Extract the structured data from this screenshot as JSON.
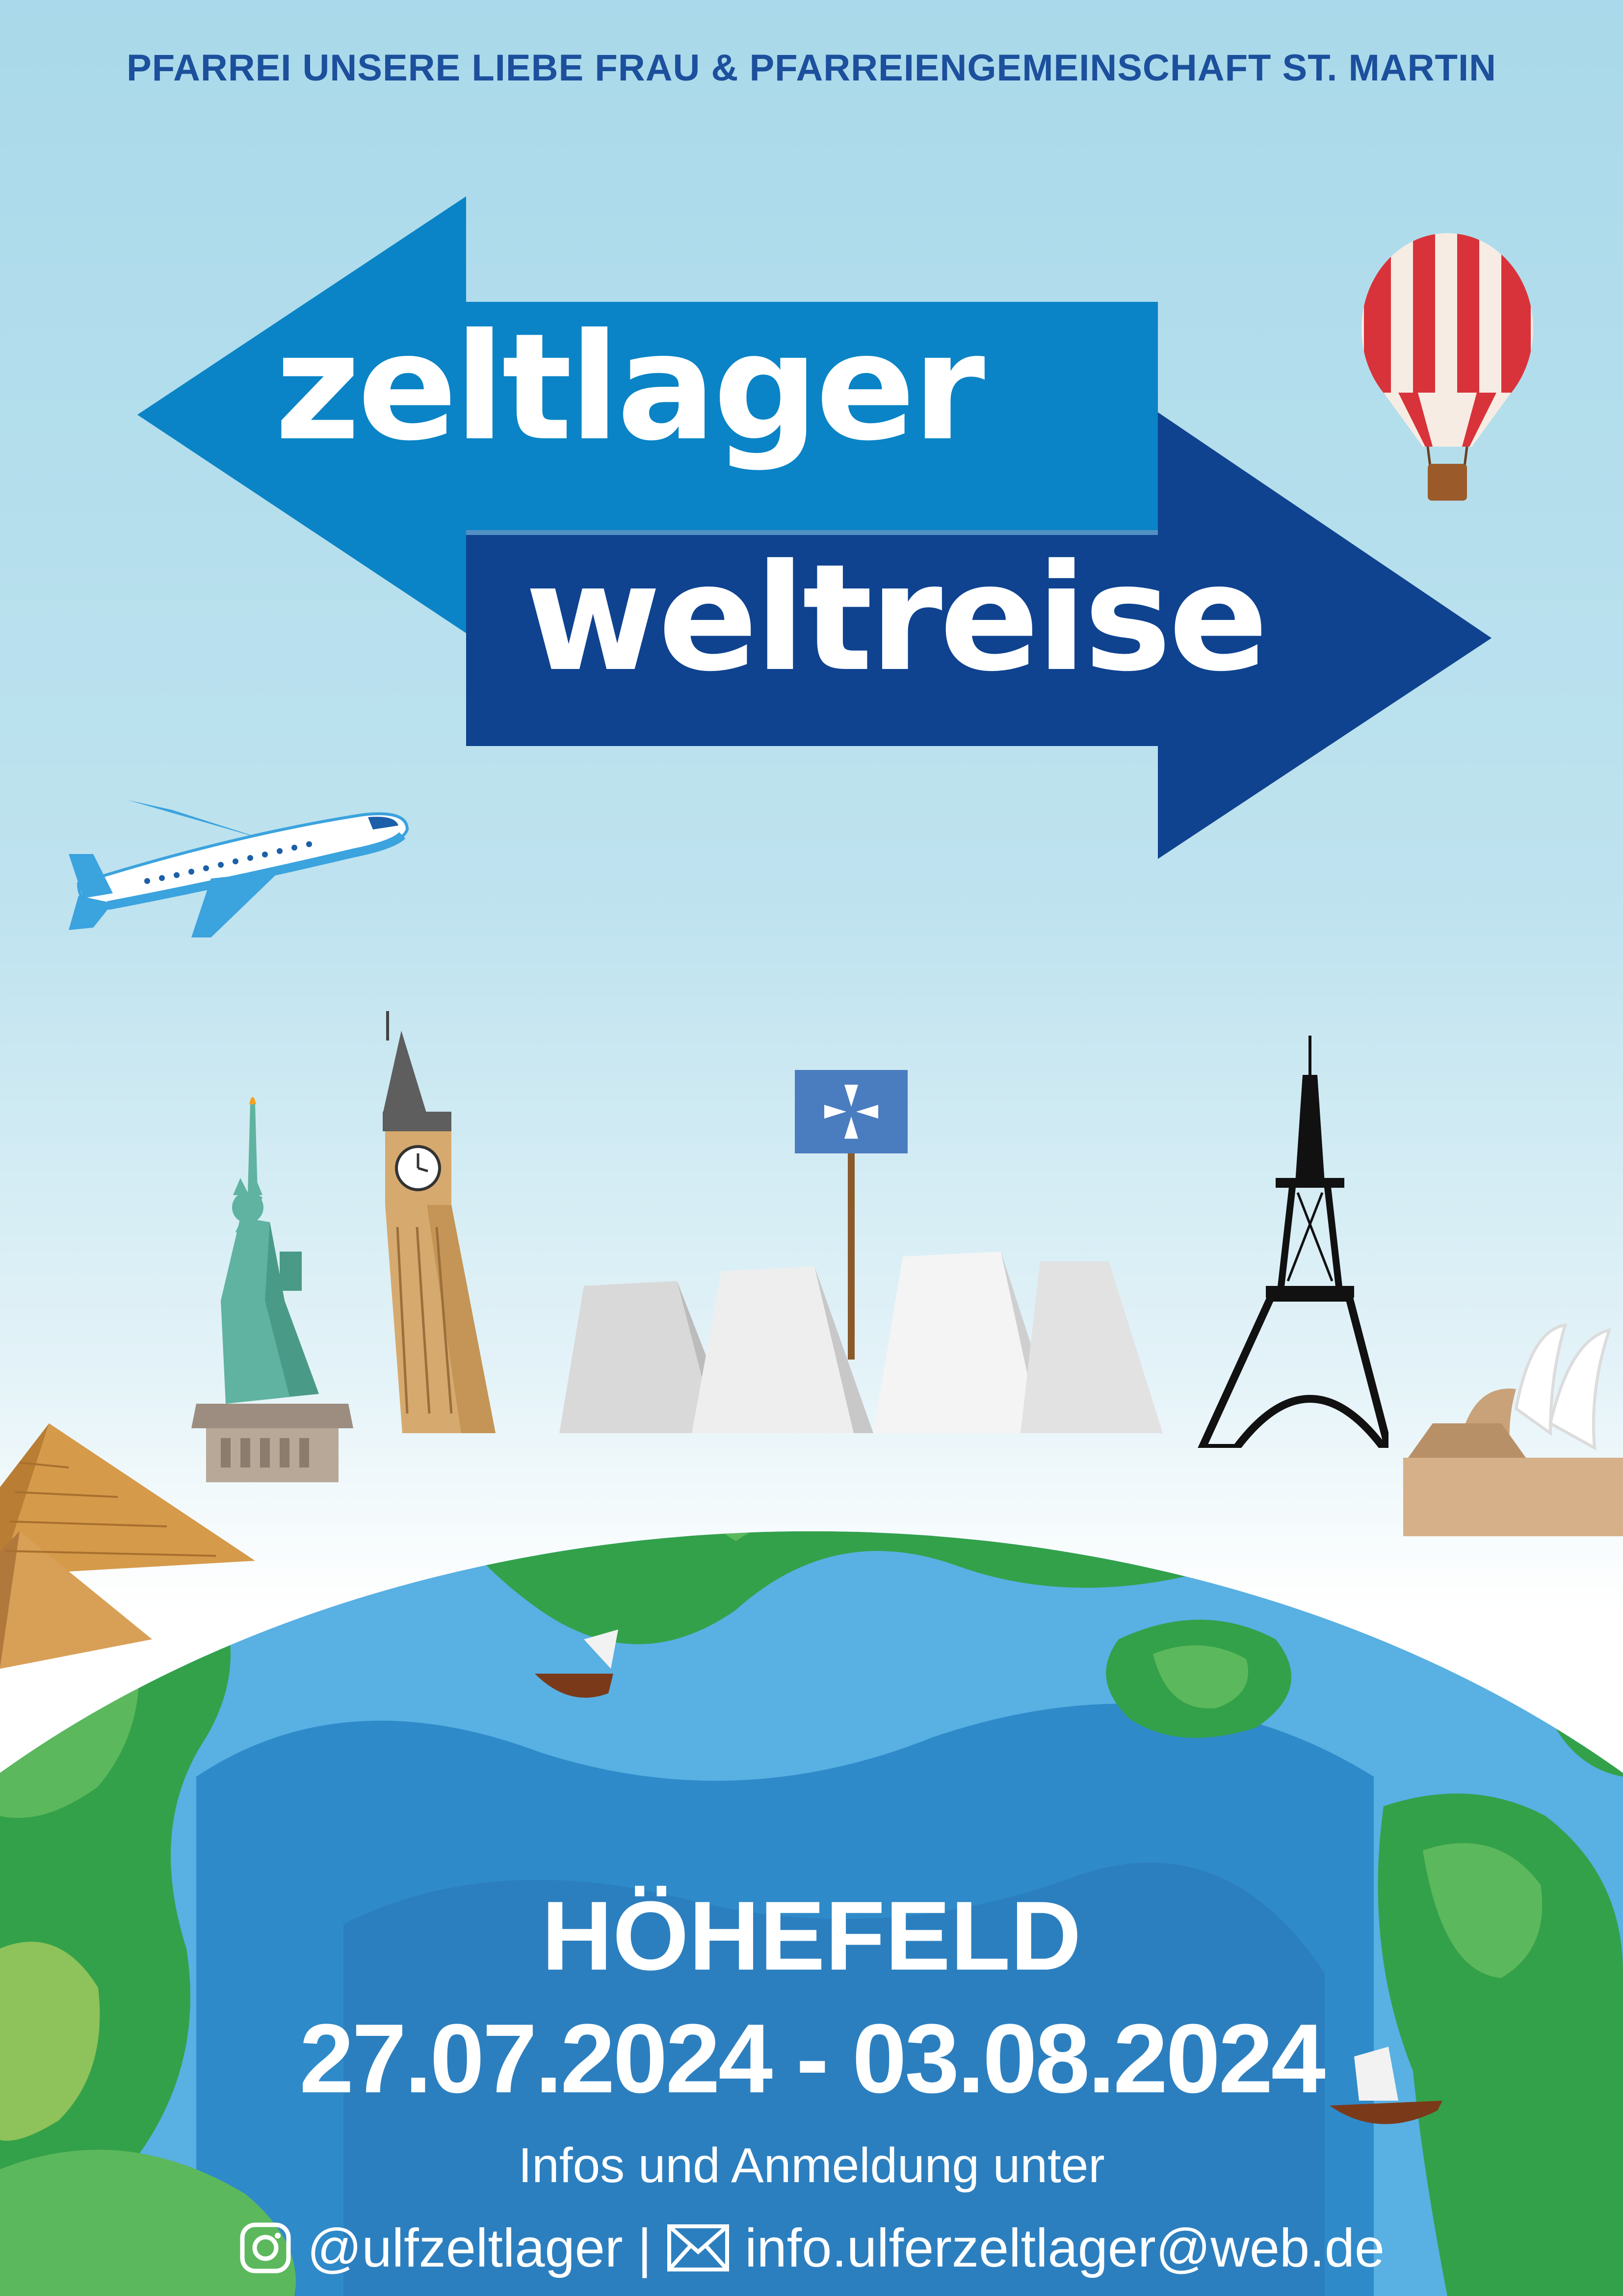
{
  "header": {
    "parishes": "PFARREI UNSERE LIEBE FRAU & PFARREIENGEMEINSCHAFT ST. MARTIN"
  },
  "title": {
    "line1": "zeltlager",
    "line2": "weltreise"
  },
  "event": {
    "location": "HÖHEFELD",
    "dates": "27.07.2024 - 03.08.2024",
    "info_label": "Infos und Anmeldung unter"
  },
  "contact": {
    "instagram": "@ulfzeltlager",
    "separator": "|",
    "email": "info.ulferzeltlager@web.de"
  },
  "icons": [
    "instagram-icon",
    "mail-icon",
    "airplane-icon",
    "hot-air-balloon-icon",
    "flag-icon"
  ],
  "colors": {
    "sky": "#a9d9ea",
    "arrow_left": "#0a84c6",
    "arrow_right": "#0f4390",
    "header_text": "#1c4f9c",
    "ocean": "#3d97d3",
    "land": "#33a14a"
  }
}
